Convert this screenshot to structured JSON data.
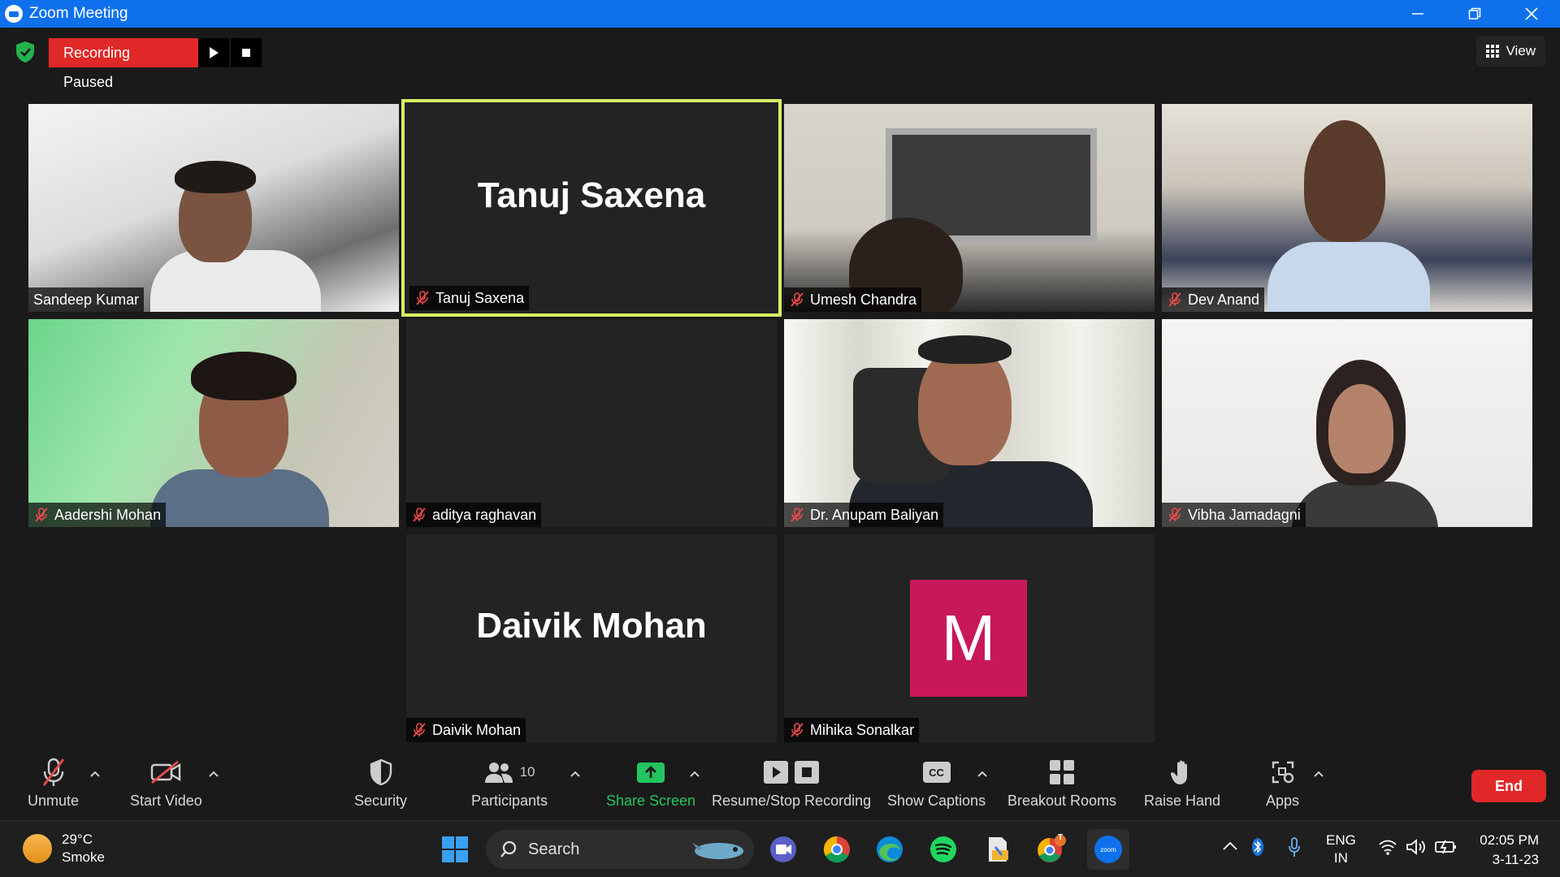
{
  "window": {
    "title": "Zoom Meeting"
  },
  "topbar": {
    "recording_status": "Recording Paused",
    "view_label": "View"
  },
  "participants_tiles": [
    {
      "name": "Sandeep Kumar",
      "muted": false,
      "video": true
    },
    {
      "name": "Tanuj Saxena",
      "muted": true,
      "video": false,
      "display_name": "Tanuj Saxena",
      "active_speaker": true
    },
    {
      "name": "Umesh Chandra",
      "muted": true,
      "video": true
    },
    {
      "name": "Dev Anand",
      "muted": true,
      "video": true
    },
    {
      "name": "Aadershi Mohan",
      "muted": true,
      "video": true
    },
    {
      "name": "aditya raghavan",
      "muted": true,
      "video": false
    },
    {
      "name": "Dr. Anupam Baliyan",
      "muted": true,
      "video": true
    },
    {
      "name": "Vibha Jamadagni",
      "muted": true,
      "video": true
    },
    {
      "name": "Daivik Mohan",
      "muted": true,
      "video": false,
      "display_name": "Daivik Mohan"
    },
    {
      "name": "Mihika Sonalkar",
      "muted": true,
      "video": false,
      "avatar_letter": "M",
      "avatar_color": "#c8185a"
    }
  ],
  "toolbar": {
    "unmute": "Unmute",
    "start_video": "Start Video",
    "security": "Security",
    "participants": "Participants",
    "participants_count": "10",
    "share_screen": "Share Screen",
    "recording": "Resume/Stop Recording",
    "captions": "Show Captions",
    "captions_icon_text": "CC",
    "breakout": "Breakout Rooms",
    "raise_hand": "Raise Hand",
    "apps": "Apps",
    "end": "End"
  },
  "colors": {
    "accent_blue": "#0e71eb",
    "end_red": "#e02828",
    "share_green": "#22c55e",
    "active_speaker_border": "#d9ef64"
  },
  "taskbar": {
    "temperature": "29°C",
    "weather": "Smoke",
    "search_label": "Search",
    "language": "ENG",
    "region": "IN",
    "time": "02:05 PM",
    "date": "3-11-23",
    "chrome_badge": "T",
    "zoom_icon_label": "zoom"
  }
}
